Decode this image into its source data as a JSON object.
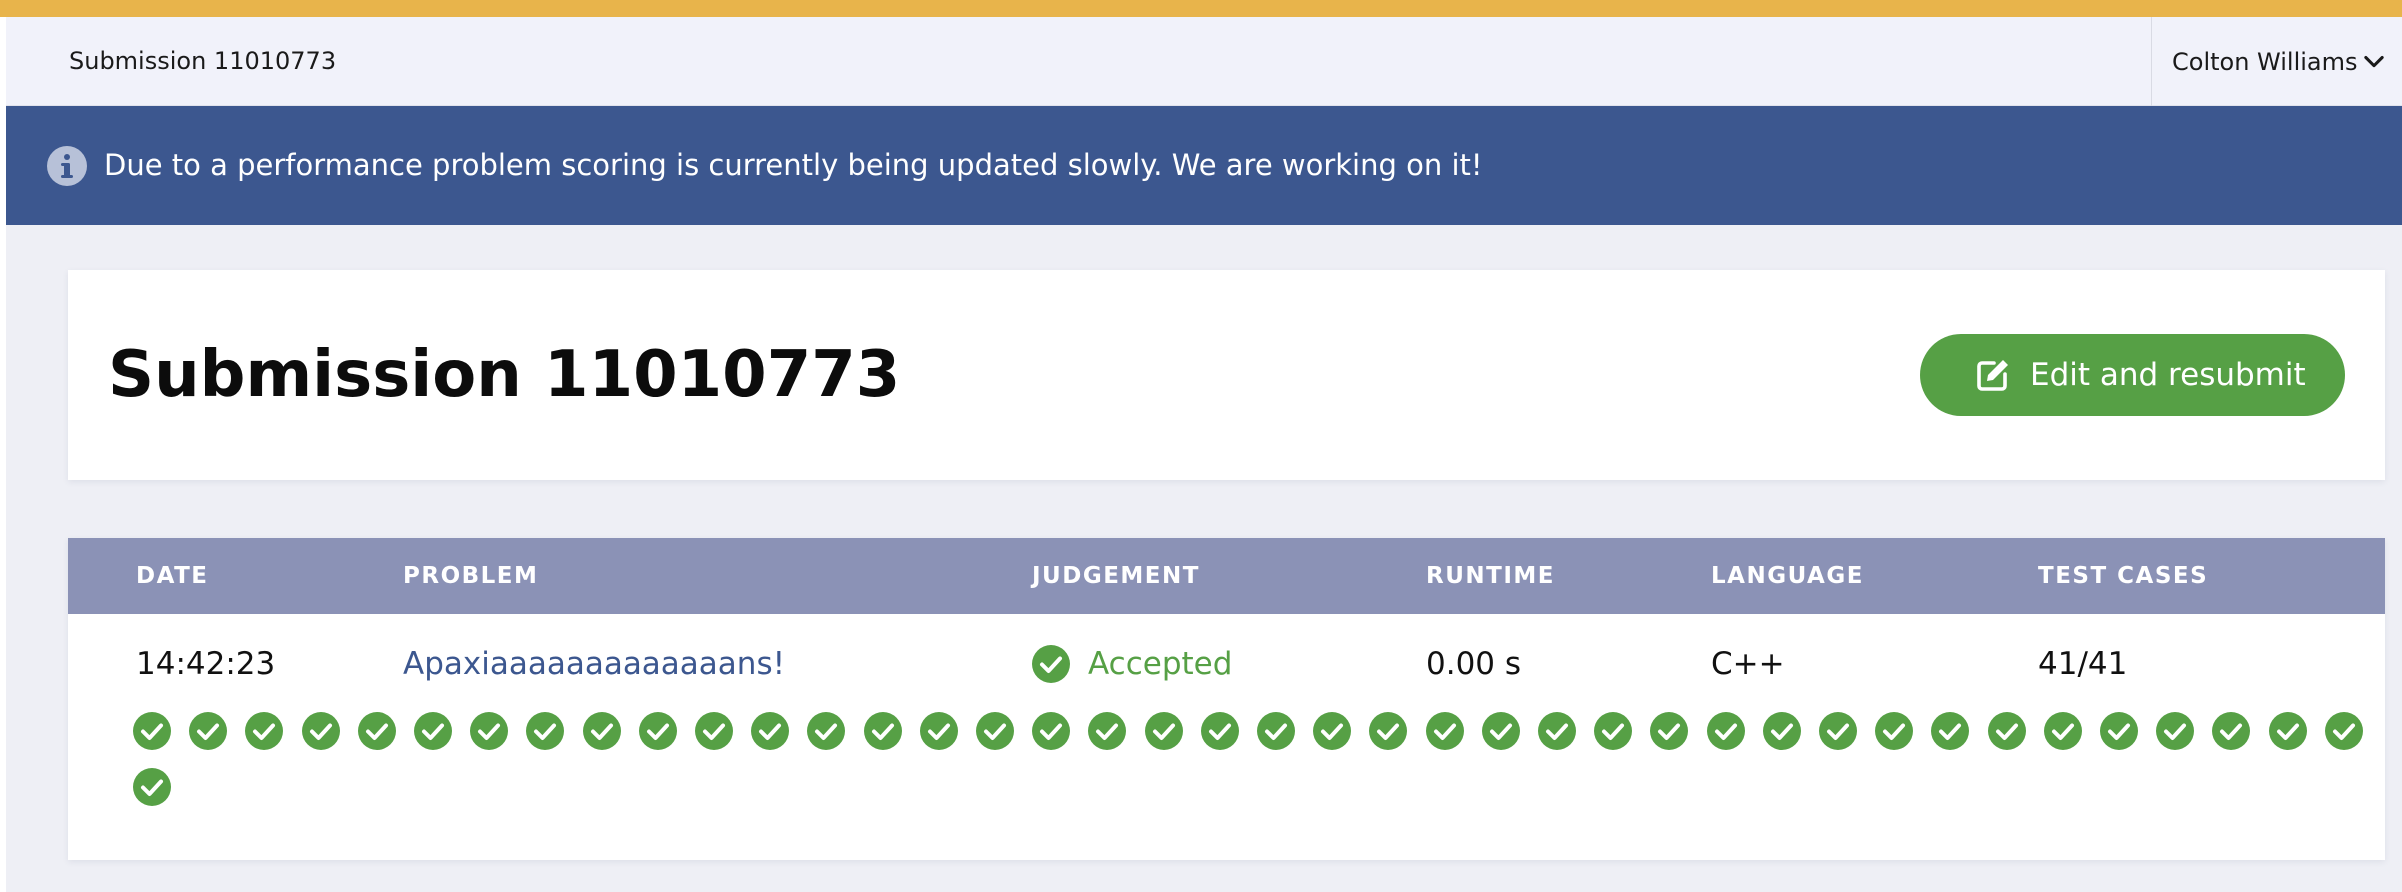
{
  "topbar": {
    "title": "Submission 11010773",
    "user_name": "Colton Williams"
  },
  "banner": {
    "icon": "info-icon",
    "text": "Due to a performance problem scoring is currently being updated slowly. We are working on it!"
  },
  "header": {
    "title": "Submission 11010773",
    "resubmit_label": "Edit and resubmit",
    "resubmit_icon": "edit-icon"
  },
  "table": {
    "columns": [
      "DATE",
      "PROBLEM",
      "JUDGEMENT",
      "RUNTIME",
      "LANGUAGE",
      "TEST CASES"
    ],
    "row": {
      "date": "14:42:23",
      "problem": "Apaxiaaaaaaaaaaaaans!",
      "judgement": "Accepted",
      "runtime": "0.00 s",
      "language": "C++",
      "test_cases": "41/41"
    }
  },
  "test_cases": {
    "total": 41,
    "passed": 41,
    "status": "accepted"
  },
  "colors": {
    "accent": "#e8b44b",
    "banner": "#3c578f",
    "success": "#56a045",
    "table_header": "#8b92b6",
    "link": "#3c578f"
  }
}
